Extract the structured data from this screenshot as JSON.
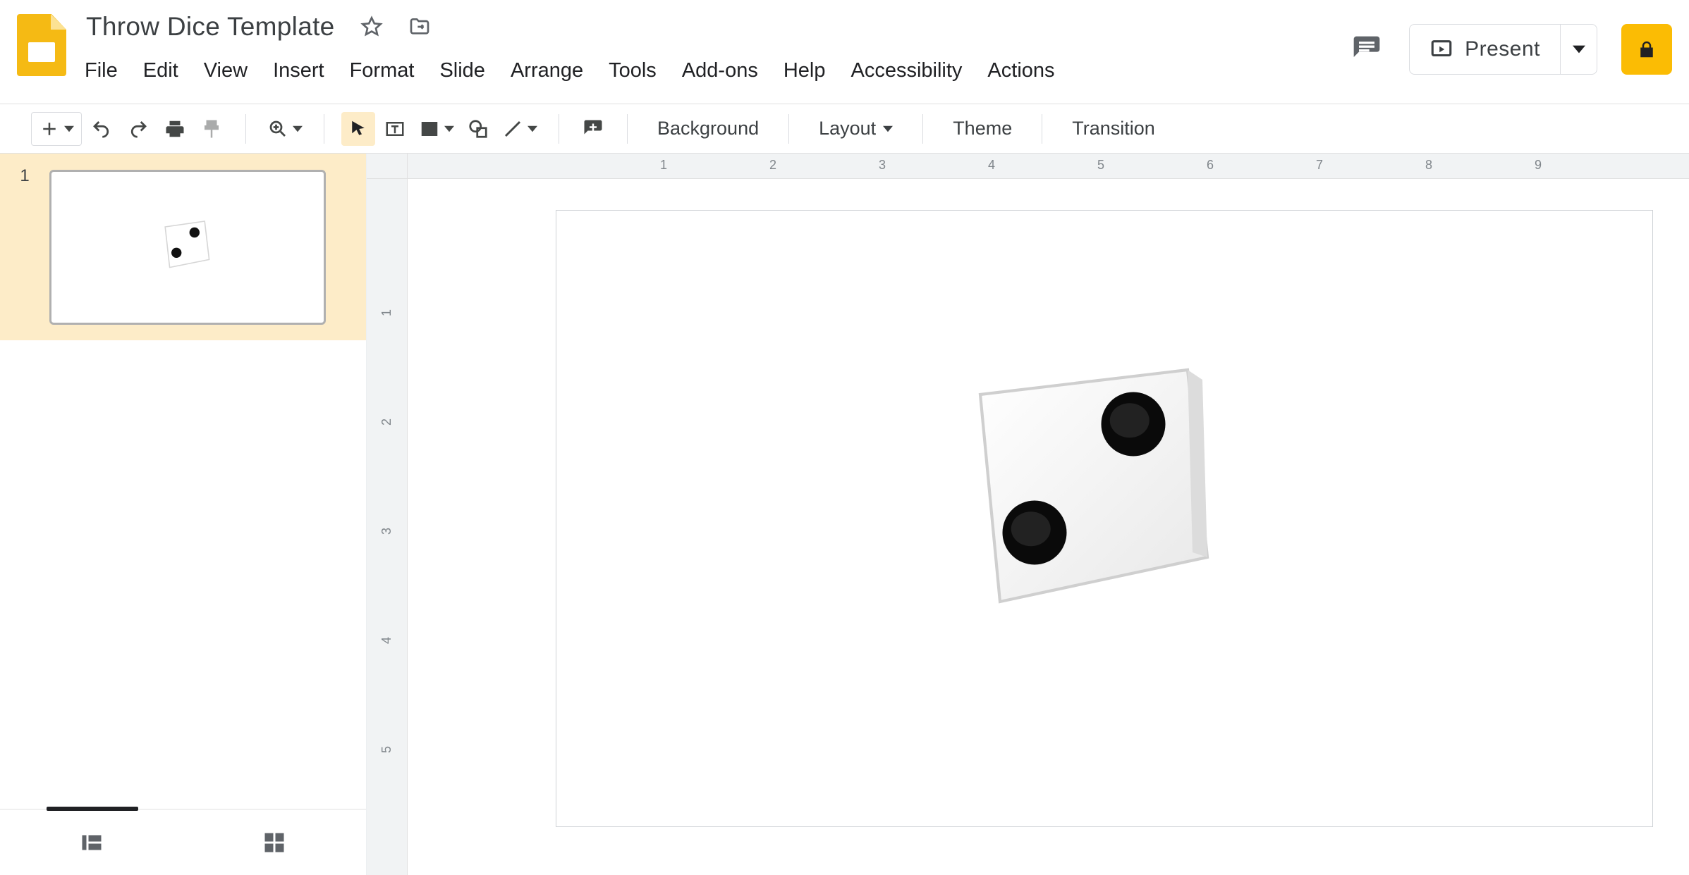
{
  "doc": {
    "title": "Throw Dice Template"
  },
  "menus": {
    "file": "File",
    "edit": "Edit",
    "view": "View",
    "insert": "Insert",
    "format": "Format",
    "slide": "Slide",
    "arrange": "Arrange",
    "tools": "Tools",
    "addons": "Add-ons",
    "help": "Help",
    "accessibility": "Accessibility",
    "actions": "Actions"
  },
  "header_controls": {
    "present_label": "Present"
  },
  "toolbar": {
    "background": "Background",
    "layout": "Layout",
    "theme": "Theme",
    "transition": "Transition"
  },
  "thumbnails": {
    "slides": [
      {
        "number": "1"
      }
    ]
  },
  "rulers": {
    "h_labels": [
      "1",
      "2",
      "3",
      "4",
      "5",
      "6",
      "7",
      "8",
      "9"
    ],
    "v_labels": [
      "1",
      "2",
      "3",
      "4",
      "5"
    ]
  },
  "slide_content": {
    "dice_face_value": 2
  }
}
